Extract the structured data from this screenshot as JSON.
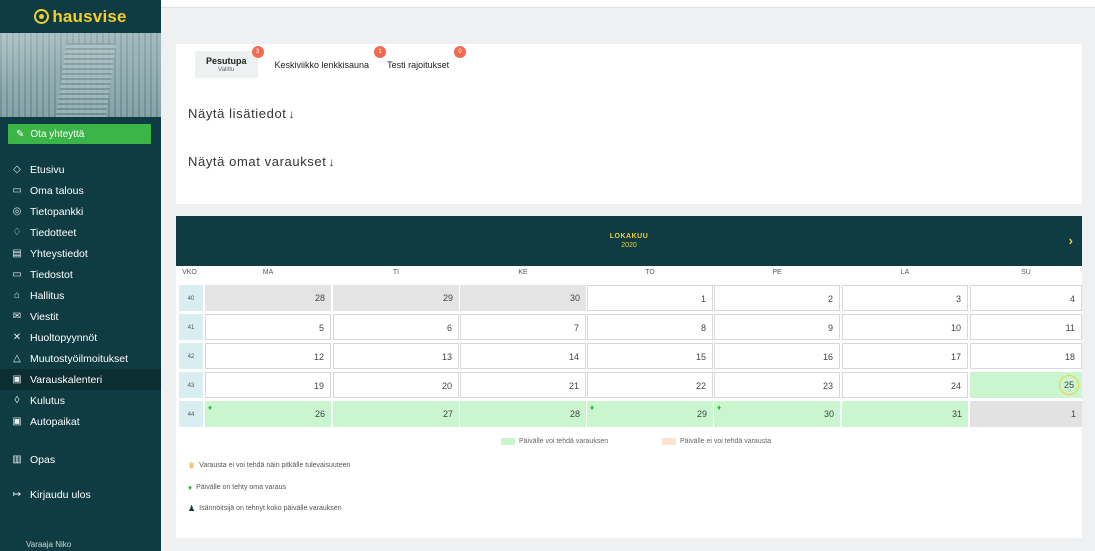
{
  "sidebar": {
    "logo": "hausvise",
    "contact_button": "Ota yhteyttä",
    "nav": [
      {
        "label": "Etusivu",
        "icon": "tag-icon",
        "glyph": "◇"
      },
      {
        "label": "Oma talous",
        "icon": "wallet-icon",
        "glyph": "▭"
      },
      {
        "label": "Tietopankki",
        "icon": "knowledge-icon",
        "glyph": "◎"
      },
      {
        "label": "Tiedotteet",
        "icon": "bell-icon",
        "glyph": "♢"
      },
      {
        "label": "Yhteystiedot",
        "icon": "contact-card-icon",
        "glyph": "▤"
      },
      {
        "label": "Tiedostot",
        "icon": "folder-icon",
        "glyph": "▭"
      },
      {
        "label": "Hallitus",
        "icon": "bank-icon",
        "glyph": "⌂"
      },
      {
        "label": "Viestit",
        "icon": "mail-icon",
        "glyph": "✉"
      },
      {
        "label": "Huoltopyynnöt",
        "icon": "tools-icon",
        "glyph": "✕"
      },
      {
        "label": "Muutostyöilmoitukset",
        "icon": "warning-icon",
        "glyph": "△"
      },
      {
        "label": "Varauskalenteri",
        "icon": "calendar-icon",
        "glyph": "▣"
      },
      {
        "label": "Kulutus",
        "icon": "drop-icon",
        "glyph": "◊"
      },
      {
        "label": "Autopaikat",
        "icon": "parking-icon",
        "glyph": "▣"
      }
    ],
    "guide": "Opas",
    "logout": "Kirjaudu ulos",
    "user": "Varaaja Niko"
  },
  "tabs": [
    {
      "label": "Pesutupa",
      "sub": "Valittu",
      "count": "3"
    },
    {
      "label": "Keskiviikko lenkkisauna",
      "count": "1"
    },
    {
      "label": "Testi rajoitukset",
      "count": "0"
    }
  ],
  "details_toggle": "Näytä lisätiedot",
  "own_bookings_toggle": "Näytä omat varaukset",
  "calendar": {
    "month": "LOKAKUU",
    "year": "2020",
    "week_header": "VKO",
    "days": [
      "MA",
      "TI",
      "KE",
      "TO",
      "PE",
      "LA",
      "SU"
    ],
    "weeks": [
      {
        "wk": "40",
        "dates": [
          "28",
          "29",
          "30",
          "1",
          "2",
          "3",
          "4"
        ]
      },
      {
        "wk": "41",
        "dates": [
          "5",
          "6",
          "7",
          "8",
          "9",
          "10",
          "11"
        ]
      },
      {
        "wk": "42",
        "dates": [
          "12",
          "13",
          "14",
          "15",
          "16",
          "17",
          "18"
        ]
      },
      {
        "wk": "43",
        "dates": [
          "19",
          "20",
          "21",
          "22",
          "23",
          "24",
          "25"
        ]
      },
      {
        "wk": "44",
        "dates": [
          "26",
          "27",
          "28",
          "29",
          "30",
          "31",
          "1"
        ]
      }
    ],
    "legend_available": "Päivälle voi tehdä varauksen",
    "legend_unavailable": "Päivälle ei voi tehdä varausta",
    "colors": {
      "available": "#c9f6cf",
      "unavailable": "#fbe2cf",
      "past": "#e4e4e4",
      "header": "#0f3c42",
      "accent": "#f3cf2e"
    }
  },
  "notes": [
    {
      "icon": "trophy-icon",
      "text": "Varausta ei voi tehdä näin pitkälle tulevaisuuteen"
    },
    {
      "icon": "pin-icon",
      "text": "Päivälle on tehty oma varaus"
    },
    {
      "icon": "person-icon",
      "text": "Isännöitsijä on tehnyt koko päivälle varauksen"
    }
  ]
}
